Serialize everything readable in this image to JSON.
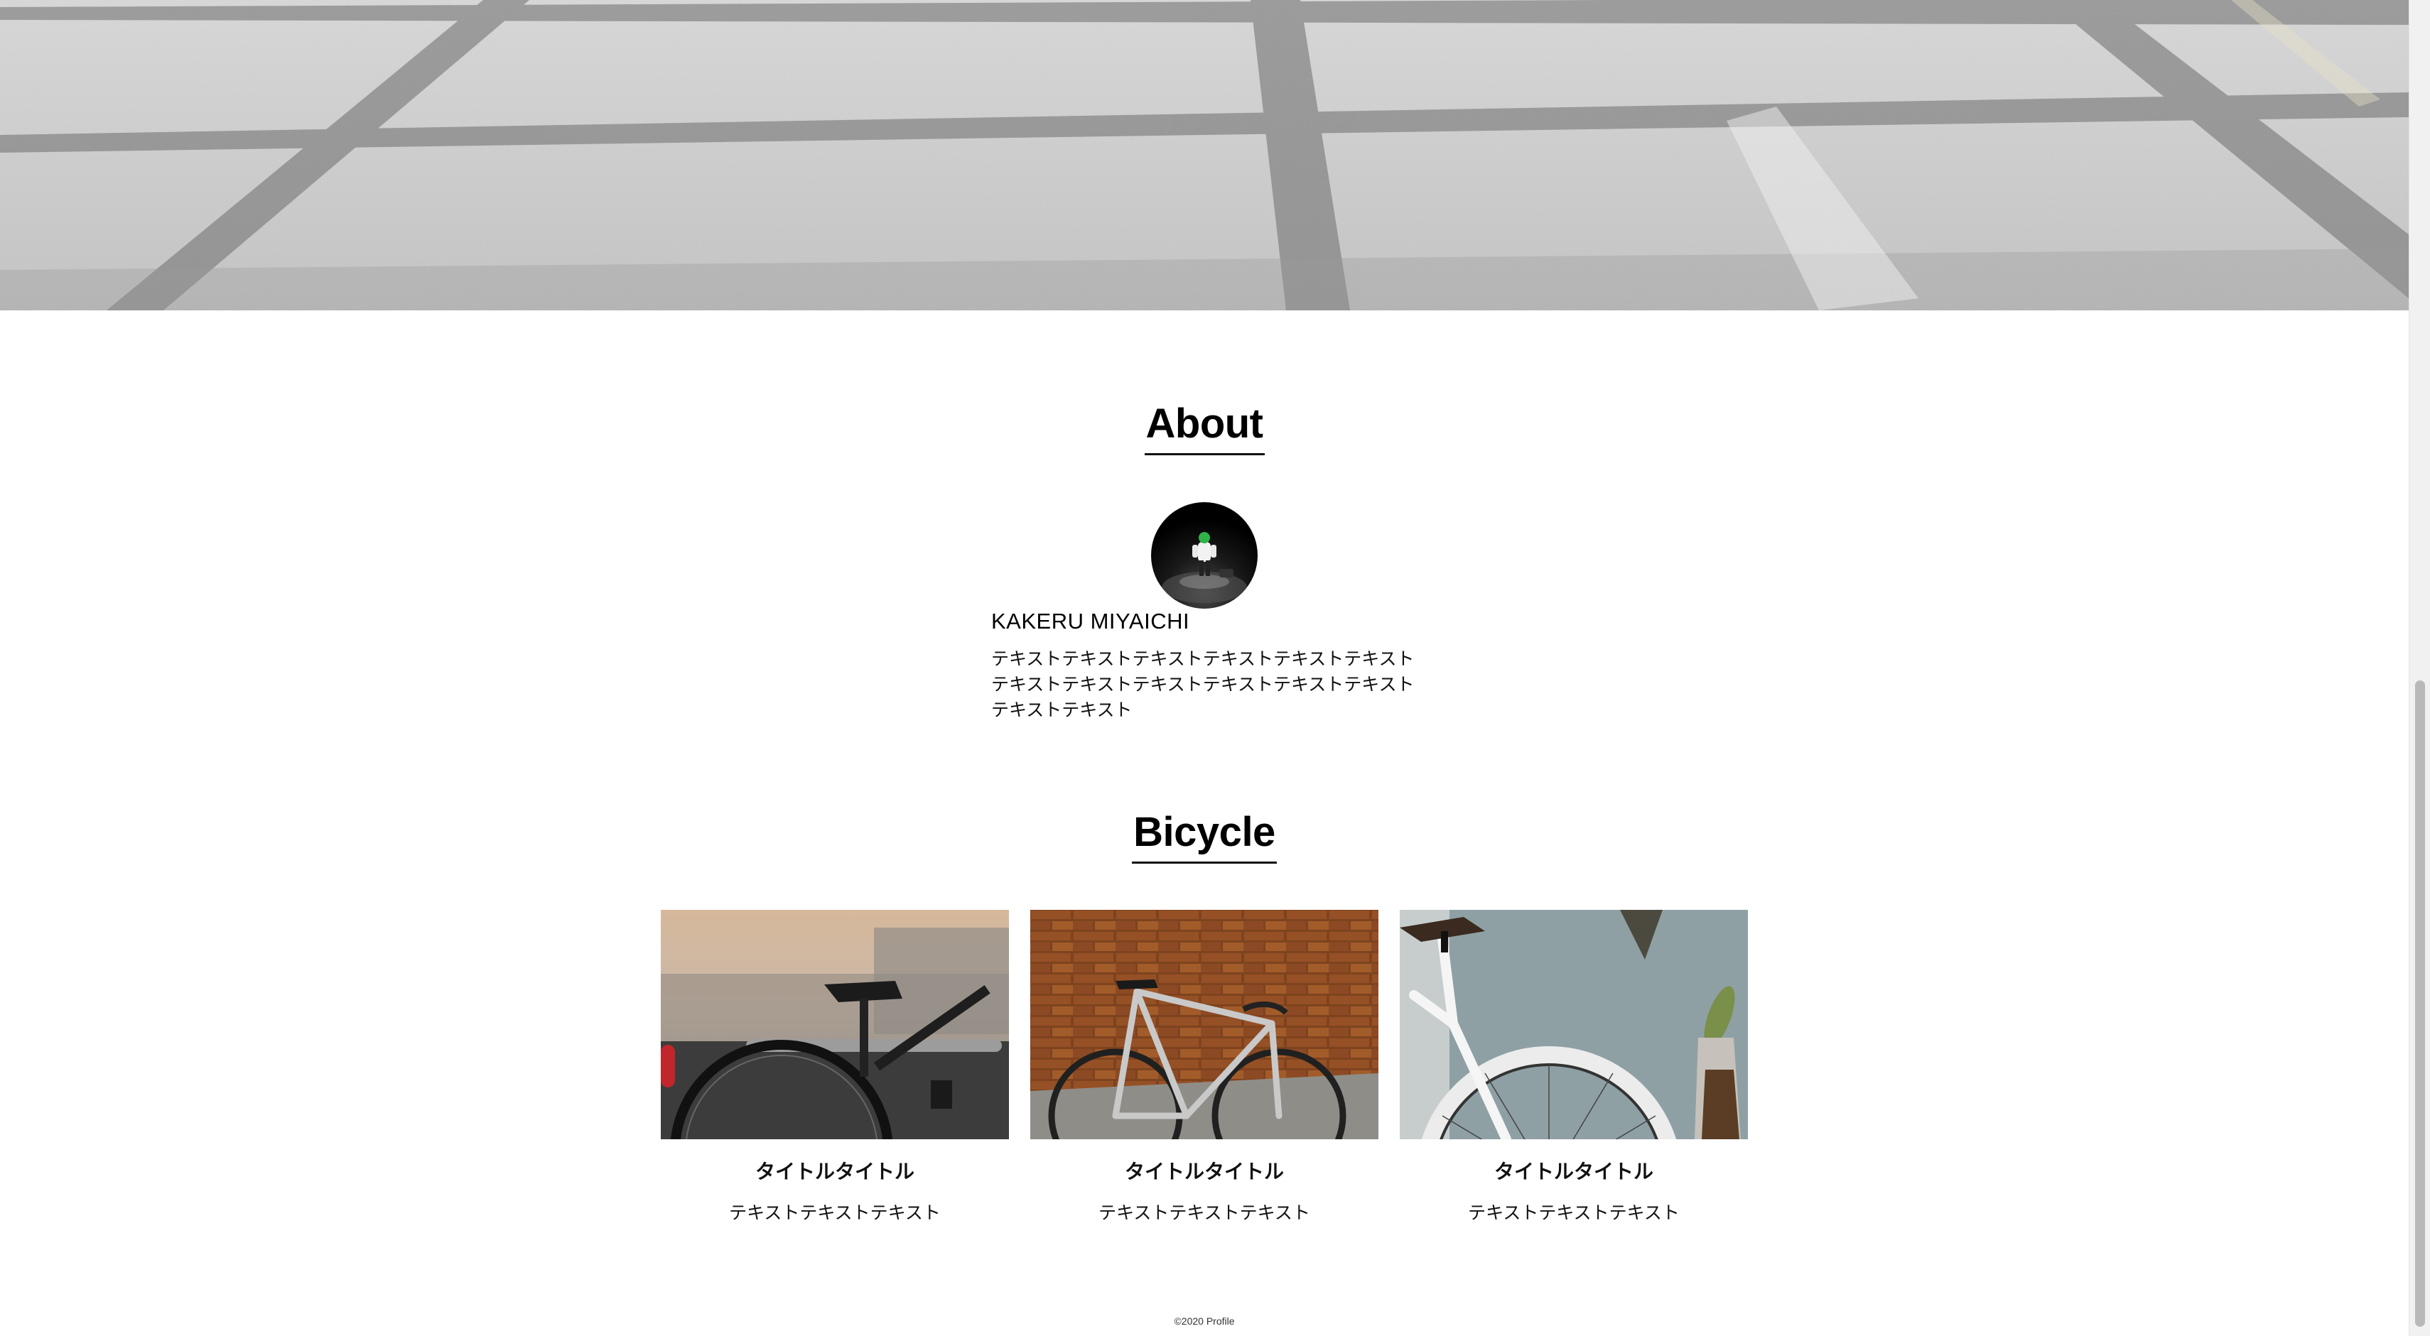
{
  "about": {
    "heading": "About",
    "name": "KAKERU MIYAICHI",
    "text": "テキストテキストテキストテキストテキストテキストテキストテキストテキストテキストテキストテキストテキストテキスト"
  },
  "bicycle": {
    "heading": "Bicycle",
    "cards": [
      {
        "title": "タイトルタイトル",
        "text": "テキストテキストテキスト"
      },
      {
        "title": "タイトルタイトル",
        "text": "テキストテキストテキスト"
      },
      {
        "title": "タイトルタイトル",
        "text": "テキストテキストテキスト"
      }
    ]
  },
  "footer": {
    "text": "©2020 Profile"
  },
  "colors": {
    "background": "#ffffff",
    "text": "#111111",
    "scrollbar_thumb": "#b9b9b9"
  }
}
